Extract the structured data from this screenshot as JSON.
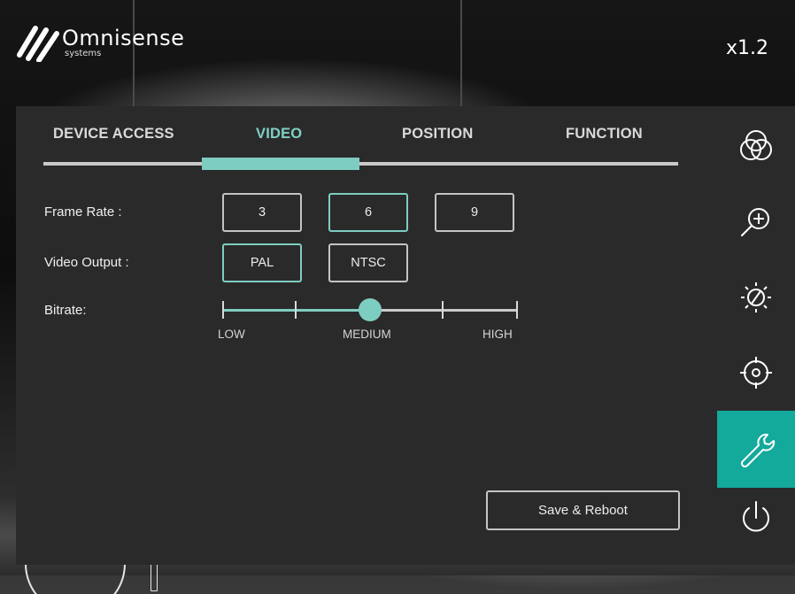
{
  "brand": {
    "name": "Omnisense",
    "sub": "systems"
  },
  "zoom": {
    "level": "x1.2"
  },
  "tabs": [
    {
      "label": "DEVICE ACCESS",
      "active": false
    },
    {
      "label": "VIDEO",
      "active": true
    },
    {
      "label": "POSITION",
      "active": false
    },
    {
      "label": "FUNCTION",
      "active": false
    }
  ],
  "video": {
    "frame_rate": {
      "label": "Frame Rate :",
      "options": [
        "3",
        "6",
        "9"
      ],
      "selected": "6"
    },
    "video_output": {
      "label": "Video Output :",
      "options": [
        "PAL",
        "NTSC"
      ],
      "selected": "PAL"
    },
    "bitrate": {
      "label": "Bitrate:",
      "levels": [
        "LOW",
        "MEDIUM",
        "HIGH"
      ],
      "value": "MEDIUM",
      "position_fraction": 0.5
    }
  },
  "save_button": {
    "label": "Save & Reboot"
  },
  "toolbar": [
    {
      "icon": "color-circles-icon",
      "active": false
    },
    {
      "icon": "zoom-in-icon",
      "active": false
    },
    {
      "icon": "brightness-icon",
      "active": false
    },
    {
      "icon": "crosshair-icon",
      "active": false
    },
    {
      "icon": "wrench-icon",
      "active": true
    },
    {
      "icon": "power-icon",
      "active": false
    }
  ],
  "colors": {
    "accent": "#7ecdc1",
    "active_tool": "#13a99b",
    "panel": "#2b2a2b"
  }
}
